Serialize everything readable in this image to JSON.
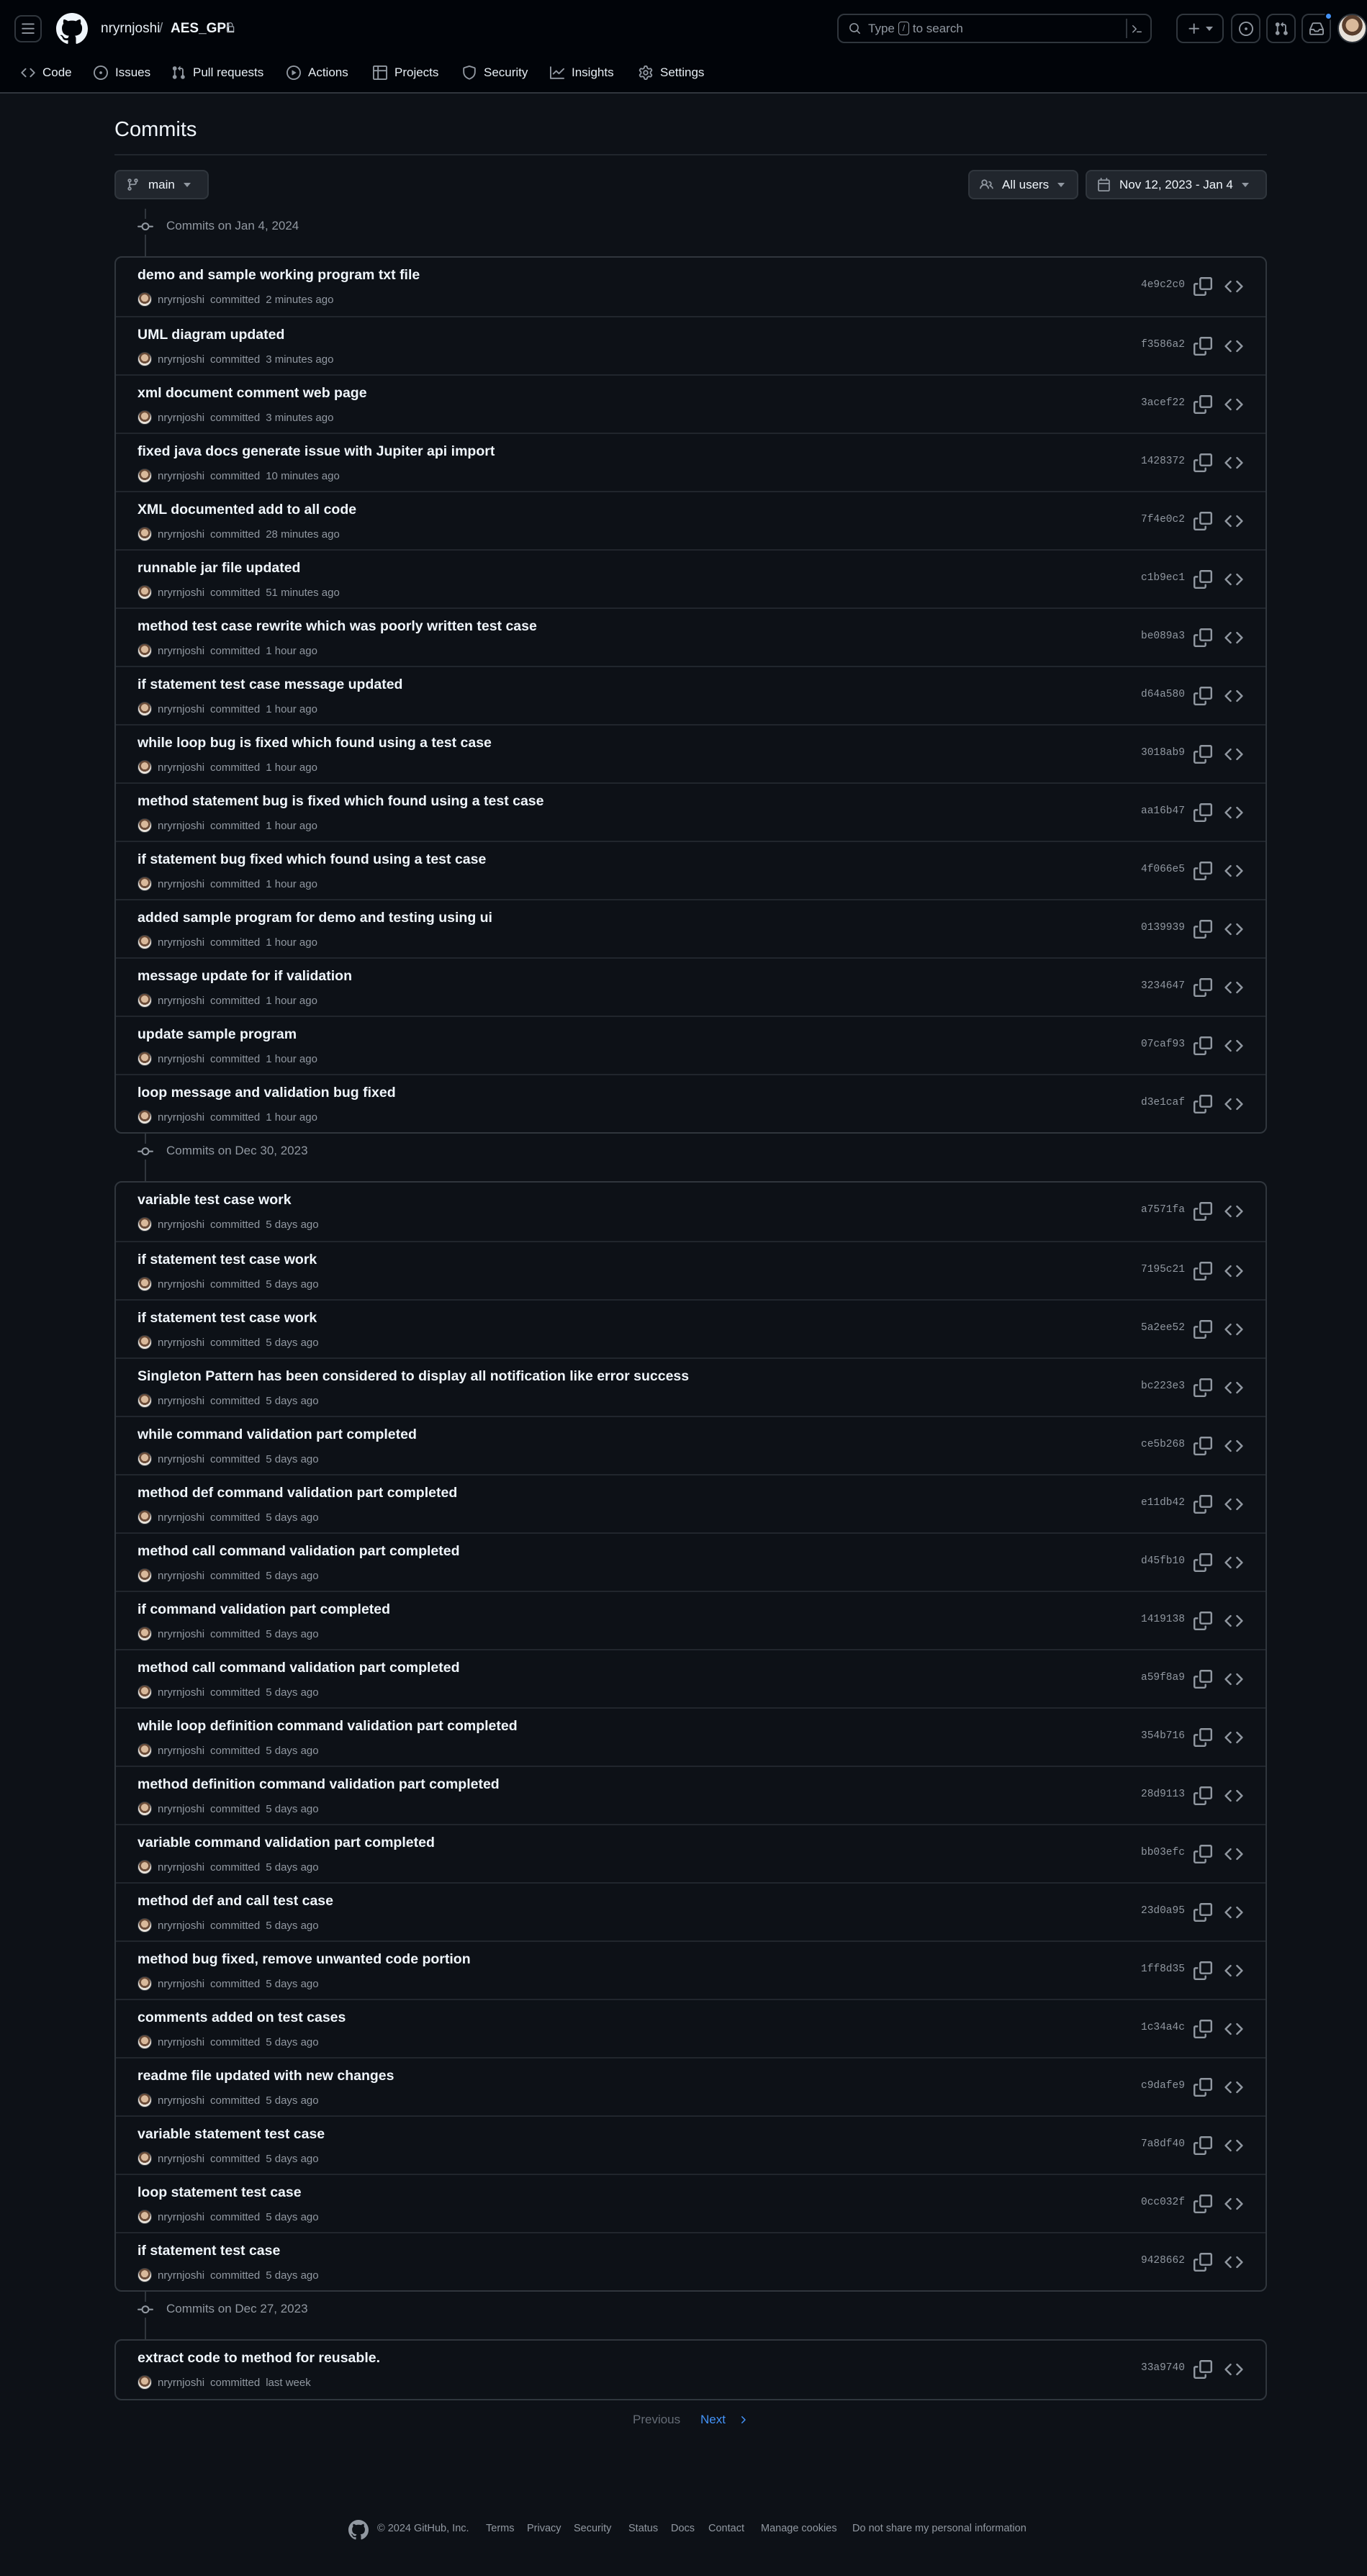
{
  "header": {
    "owner": "nryrnjoshi",
    "separator": "/",
    "repo": "AES_GPL",
    "search_prefix": "Type",
    "search_key": "/",
    "search_suffix": "to search"
  },
  "tabs": [
    {
      "label": "Code",
      "icon": "code-icon"
    },
    {
      "label": "Issues",
      "icon": "issue-icon"
    },
    {
      "label": "Pull requests",
      "icon": "pull-request-icon"
    },
    {
      "label": "Actions",
      "icon": "play-icon"
    },
    {
      "label": "Projects",
      "icon": "table-icon"
    },
    {
      "label": "Security",
      "icon": "shield-icon"
    },
    {
      "label": "Insights",
      "icon": "graph-icon"
    },
    {
      "label": "Settings",
      "icon": "gear-icon"
    }
  ],
  "page": {
    "title": "Commits",
    "branch": "main",
    "users_filter": "All users",
    "date_filter": "Nov 12, 2023 - Jan 4"
  },
  "groups": [
    {
      "date_label": "Commits on Jan 4, 2024",
      "commits": [
        {
          "message": "demo and sample working program txt file",
          "author": "nryrnjoshi",
          "action": "committed",
          "time": "2 minutes ago",
          "sha": "4e9c2c0"
        },
        {
          "message": "UML diagram updated",
          "author": "nryrnjoshi",
          "action": "committed",
          "time": "3 minutes ago",
          "sha": "f3586a2"
        },
        {
          "message": "xml document comment web page",
          "author": "nryrnjoshi",
          "action": "committed",
          "time": "3 minutes ago",
          "sha": "3acef22"
        },
        {
          "message": "fixed java docs generate issue with Jupiter api import",
          "author": "nryrnjoshi",
          "action": "committed",
          "time": "10 minutes ago",
          "sha": "1428372"
        },
        {
          "message": "XML documented add to all code",
          "author": "nryrnjoshi",
          "action": "committed",
          "time": "28 minutes ago",
          "sha": "7f4e0c2"
        },
        {
          "message": "runnable jar file updated",
          "author": "nryrnjoshi",
          "action": "committed",
          "time": "51 minutes ago",
          "sha": "c1b9ec1"
        },
        {
          "message": "method test case rewrite which was poorly written test case",
          "author": "nryrnjoshi",
          "action": "committed",
          "time": "1 hour ago",
          "sha": "be089a3"
        },
        {
          "message": "if statement test case message updated",
          "author": "nryrnjoshi",
          "action": "committed",
          "time": "1 hour ago",
          "sha": "d64a580"
        },
        {
          "message": "while loop bug is fixed which found using a test case",
          "author": "nryrnjoshi",
          "action": "committed",
          "time": "1 hour ago",
          "sha": "3018ab9"
        },
        {
          "message": "method statement bug is fixed which found using a test case",
          "author": "nryrnjoshi",
          "action": "committed",
          "time": "1 hour ago",
          "sha": "aa16b47"
        },
        {
          "message": "if statement bug fixed which found using a test case",
          "author": "nryrnjoshi",
          "action": "committed",
          "time": "1 hour ago",
          "sha": "4f066e5"
        },
        {
          "message": "added sample program for demo and testing using ui",
          "author": "nryrnjoshi",
          "action": "committed",
          "time": "1 hour ago",
          "sha": "0139939"
        },
        {
          "message": "message update for if validation",
          "author": "nryrnjoshi",
          "action": "committed",
          "time": "1 hour ago",
          "sha": "3234647"
        },
        {
          "message": "update sample program",
          "author": "nryrnjoshi",
          "action": "committed",
          "time": "1 hour ago",
          "sha": "07caf93"
        },
        {
          "message": "loop message and validation bug fixed",
          "author": "nryrnjoshi",
          "action": "committed",
          "time": "1 hour ago",
          "sha": "d3e1caf"
        }
      ]
    },
    {
      "date_label": "Commits on Dec 30, 2023",
      "commits": [
        {
          "message": "variable test case work",
          "author": "nryrnjoshi",
          "action": "committed",
          "time": "5 days ago",
          "sha": "a7571fa"
        },
        {
          "message": "if statement test case work",
          "author": "nryrnjoshi",
          "action": "committed",
          "time": "5 days ago",
          "sha": "7195c21"
        },
        {
          "message": "if statement test case work",
          "author": "nryrnjoshi",
          "action": "committed",
          "time": "5 days ago",
          "sha": "5a2ee52"
        },
        {
          "message": "Singleton Pattern has been considered to display all notification like error success",
          "author": "nryrnjoshi",
          "action": "committed",
          "time": "5 days ago",
          "sha": "bc223e3"
        },
        {
          "message": "while command validation part completed",
          "author": "nryrnjoshi",
          "action": "committed",
          "time": "5 days ago",
          "sha": "ce5b268"
        },
        {
          "message": "method def command validation part completed",
          "author": "nryrnjoshi",
          "action": "committed",
          "time": "5 days ago",
          "sha": "e11db42"
        },
        {
          "message": "method call command validation part completed",
          "author": "nryrnjoshi",
          "action": "committed",
          "time": "5 days ago",
          "sha": "d45fb10"
        },
        {
          "message": "if command validation part completed",
          "author": "nryrnjoshi",
          "action": "committed",
          "time": "5 days ago",
          "sha": "1419138"
        },
        {
          "message": "method call command validation part completed",
          "author": "nryrnjoshi",
          "action": "committed",
          "time": "5 days ago",
          "sha": "a59f8a9"
        },
        {
          "message": "while loop definition command validation part completed",
          "author": "nryrnjoshi",
          "action": "committed",
          "time": "5 days ago",
          "sha": "354b716"
        },
        {
          "message": "method definition command validation part completed",
          "author": "nryrnjoshi",
          "action": "committed",
          "time": "5 days ago",
          "sha": "28d9113"
        },
        {
          "message": "variable command validation part completed",
          "author": "nryrnjoshi",
          "action": "committed",
          "time": "5 days ago",
          "sha": "bb03efc"
        },
        {
          "message": "method def and call test case",
          "author": "nryrnjoshi",
          "action": "committed",
          "time": "5 days ago",
          "sha": "23d0a95"
        },
        {
          "message": "method bug fixed, remove unwanted code portion",
          "author": "nryrnjoshi",
          "action": "committed",
          "time": "5 days ago",
          "sha": "1ff8d35"
        },
        {
          "message": "comments added on test cases",
          "author": "nryrnjoshi",
          "action": "committed",
          "time": "5 days ago",
          "sha": "1c34a4c"
        },
        {
          "message": "readme file updated with new changes",
          "author": "nryrnjoshi",
          "action": "committed",
          "time": "5 days ago",
          "sha": "c9dafe9"
        },
        {
          "message": "variable statement test case",
          "author": "nryrnjoshi",
          "action": "committed",
          "time": "5 days ago",
          "sha": "7a8df40"
        },
        {
          "message": "loop statement test case",
          "author": "nryrnjoshi",
          "action": "committed",
          "time": "5 days ago",
          "sha": "0cc032f"
        },
        {
          "message": "if statement test case",
          "author": "nryrnjoshi",
          "action": "committed",
          "time": "5 days ago",
          "sha": "9428662"
        }
      ]
    },
    {
      "date_label": "Commits on Dec 27, 2023",
      "commits": [
        {
          "message": "extract code to method for reusable.",
          "author": "nryrnjoshi",
          "action": "committed",
          "time": "last week",
          "sha": "33a9740"
        }
      ]
    }
  ],
  "pagination": {
    "previous": "Previous",
    "next": "Next"
  },
  "footer": {
    "copyright": "© 2024 GitHub, Inc.",
    "links": [
      "Terms",
      "Privacy",
      "Security",
      "Status",
      "Docs",
      "Contact",
      "Manage cookies",
      "Do not share my personal information"
    ]
  },
  "colors": {
    "background": "#0d1117",
    "header": "#010409",
    "border": "#30363d",
    "muted": "#9198a1",
    "link": "#4493f8",
    "notification": "#4493f8"
  }
}
